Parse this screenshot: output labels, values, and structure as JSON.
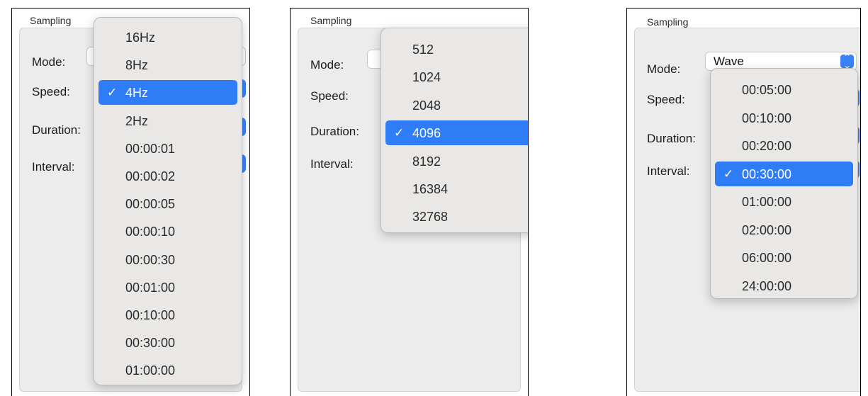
{
  "panels": [
    {
      "group_title": "Sampling",
      "labels": {
        "mode": "Mode:",
        "speed": "Speed:",
        "duration": "Duration:",
        "interval": "Interval:"
      },
      "menu": {
        "items": [
          "16Hz",
          "8Hz",
          "4Hz",
          "2Hz",
          "00:00:01",
          "00:00:02",
          "00:00:05",
          "00:00:10",
          "00:00:30",
          "00:01:00",
          "00:10:00",
          "00:30:00",
          "01:00:00"
        ],
        "selected": "4Hz"
      }
    },
    {
      "group_title": "Sampling",
      "labels": {
        "mode": "Mode:",
        "speed": "Speed:",
        "duration": "Duration:",
        "interval": "Interval:"
      },
      "menu": {
        "items": [
          "512",
          "1024",
          "2048",
          "4096",
          "8192",
          "16384",
          "32768"
        ],
        "selected": "4096"
      }
    },
    {
      "group_title": "Sampling",
      "labels": {
        "mode": "Mode:",
        "speed": "Speed:",
        "duration": "Duration:",
        "interval": "Interval:"
      },
      "mode_value": "Wave",
      "menu": {
        "items": [
          "00:05:00",
          "00:10:00",
          "00:20:00",
          "00:30:00",
          "01:00:00",
          "02:00:00",
          "06:00:00",
          "24:00:00"
        ],
        "selected": "00:30:00"
      }
    }
  ],
  "check_glyph": "✓",
  "colors": {
    "selection": "#2f7df6",
    "accent": "#3b82f6"
  }
}
